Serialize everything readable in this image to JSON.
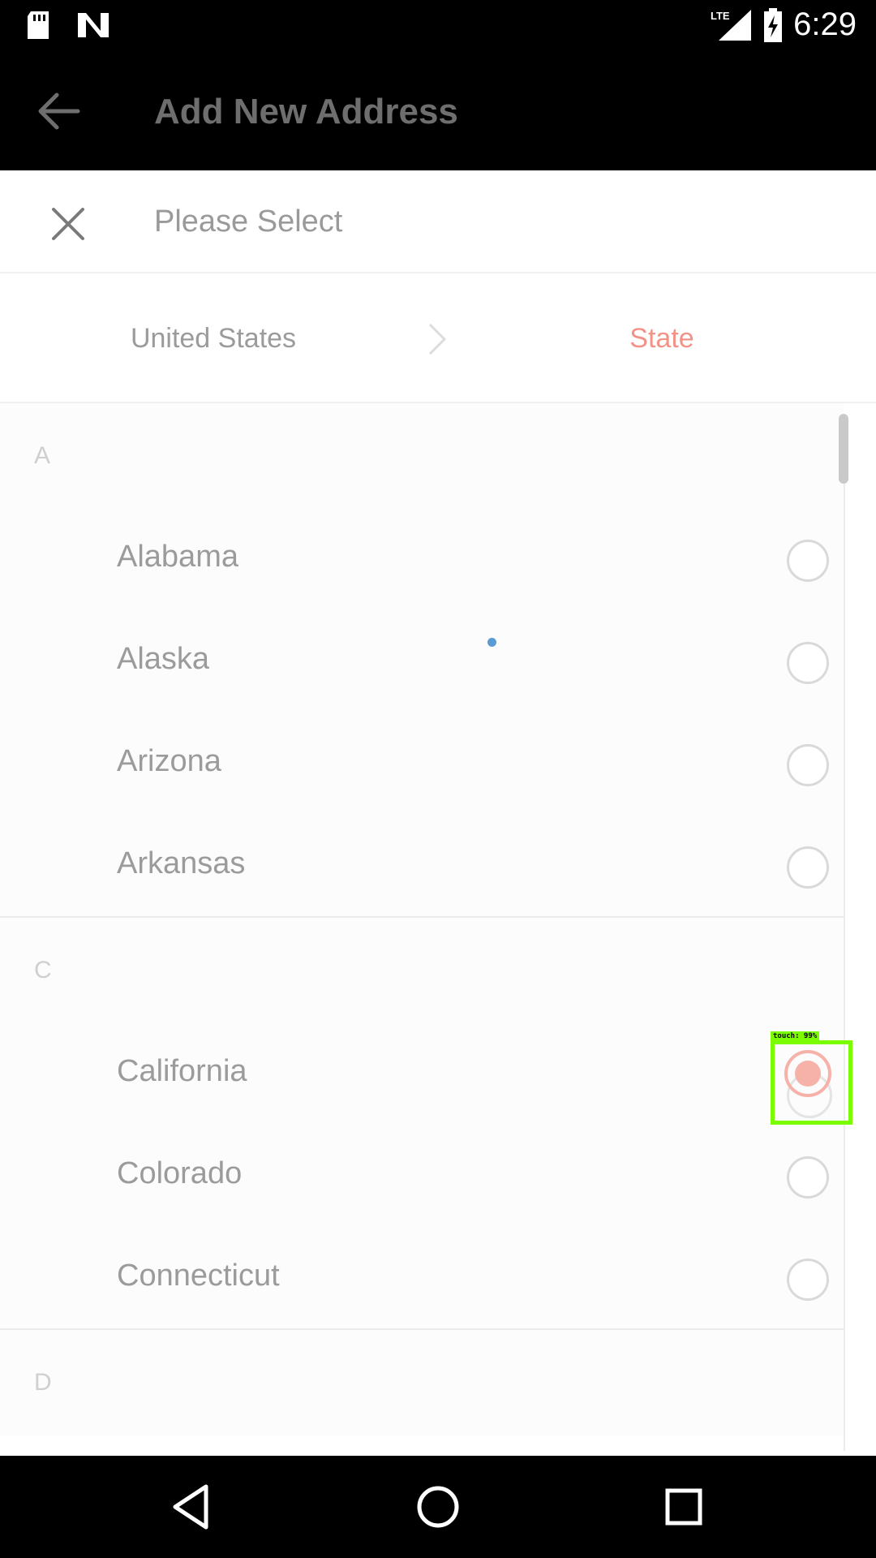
{
  "status_bar": {
    "time": "6:29",
    "network": "LTE",
    "icons": [
      "sd-card-icon",
      "n-logo-icon",
      "lte-signal-icon",
      "battery-charging-icon"
    ]
  },
  "app_bar": {
    "title": "Add New Address",
    "back_icon": "arrow-left-icon"
  },
  "sheet": {
    "title": "Please Select",
    "close_icon": "close-icon",
    "breadcrumb": {
      "country": "United States",
      "current": "State",
      "active_color": "#f29388"
    }
  },
  "list": {
    "sections": [
      {
        "letter": "A",
        "items": [
          "Alabama",
          "Alaska",
          "Arizona",
          "Arkansas"
        ]
      },
      {
        "letter": "C",
        "items": [
          "California",
          "Colorado",
          "Connecticut"
        ]
      },
      {
        "letter": "D",
        "items": []
      }
    ]
  },
  "overlay": {
    "touch_label": "touch: 99%",
    "touch_color": "#7cfc00"
  },
  "nav_bar": {
    "icons": [
      "back-triangle-icon",
      "home-circle-icon",
      "recents-square-icon"
    ]
  }
}
